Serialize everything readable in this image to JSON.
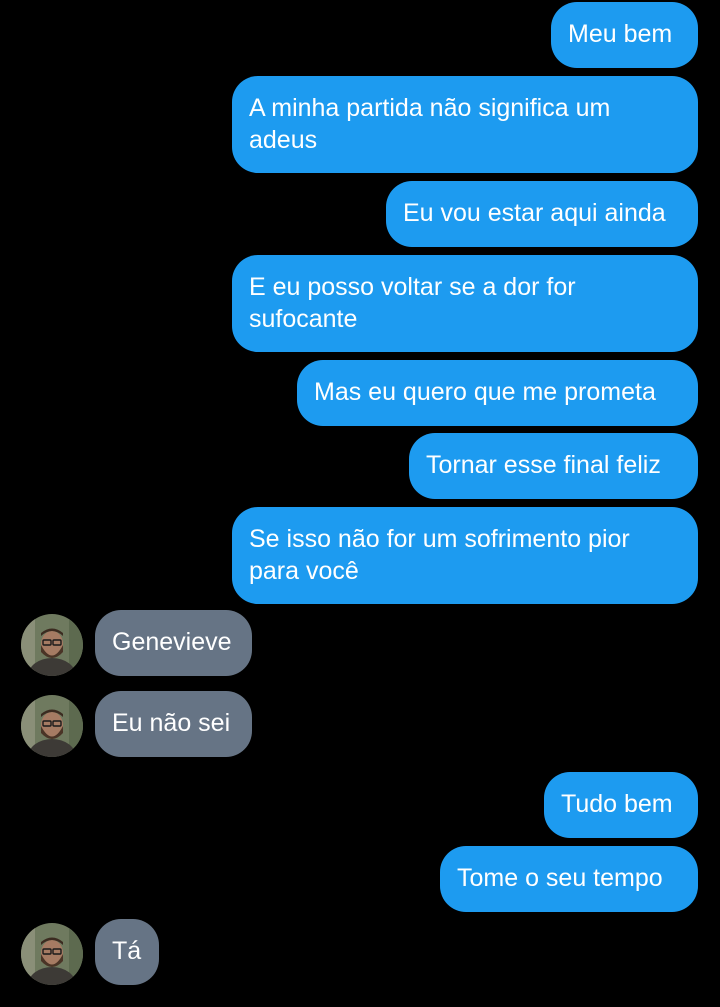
{
  "conversation": {
    "outgoing_color": "#1d9bf0",
    "incoming_color": "#667485",
    "messages": [
      {
        "side": "outgoing",
        "text": "Meu bem"
      },
      {
        "side": "outgoing",
        "text": "A minha partida não significa um adeus"
      },
      {
        "side": "outgoing",
        "text": "Eu vou estar aqui ainda"
      },
      {
        "side": "outgoing",
        "text": "E eu posso voltar se a dor for sufocante"
      },
      {
        "side": "outgoing",
        "text": "Mas eu quero que me prometa"
      },
      {
        "side": "outgoing",
        "text": "Tornar esse final feliz"
      },
      {
        "side": "outgoing",
        "text": "Se isso não for um sofrimento pior para você"
      },
      {
        "side": "incoming",
        "text": "Genevieve",
        "avatar": "contact-avatar"
      },
      {
        "side": "incoming",
        "text": "Eu não sei",
        "avatar": "contact-avatar"
      },
      {
        "side": "outgoing",
        "text": "Tudo bem"
      },
      {
        "side": "outgoing",
        "text": "Tome o seu tempo"
      },
      {
        "side": "incoming",
        "text": "Tá",
        "avatar": "contact-avatar"
      }
    ]
  }
}
